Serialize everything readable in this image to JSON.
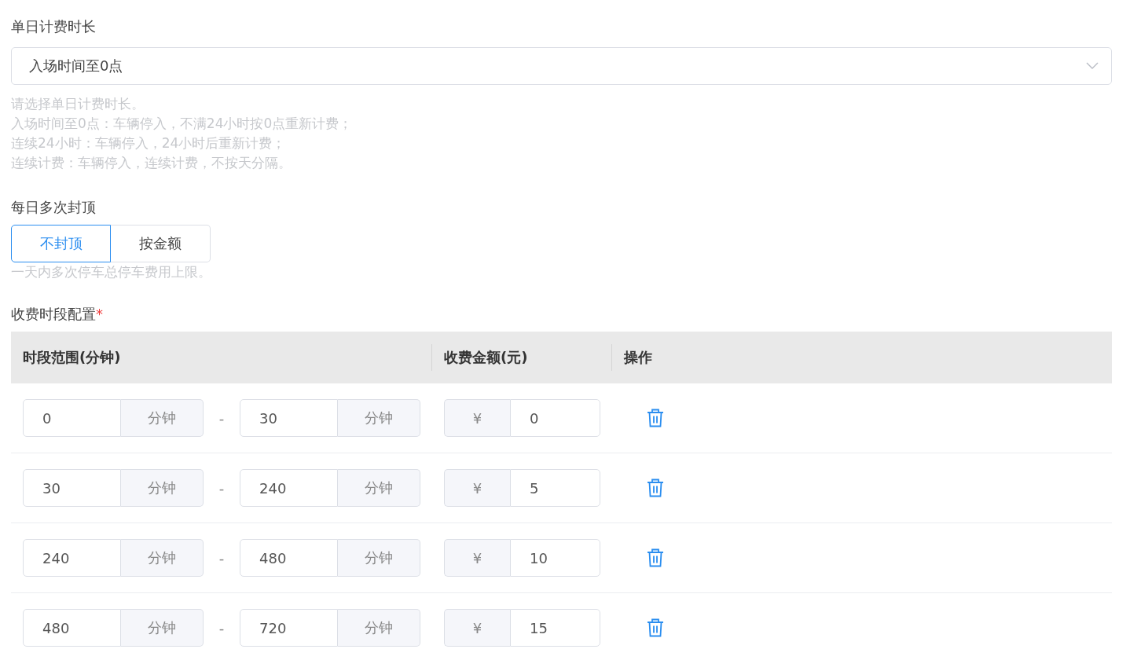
{
  "duration": {
    "label": "单日计费时长",
    "value": "入场时间至0点",
    "help": [
      "请选择单日计费时长。",
      "入场时间至0点：车辆停入，不满24小时按0点重新计费；",
      "连续24小时：车辆停入，24小时后重新计费；",
      "连续计费：车辆停入，连续计费，不按天分隔。"
    ]
  },
  "cap": {
    "label": "每日多次封顶",
    "options": [
      {
        "label": "不封顶",
        "selected": true
      },
      {
        "label": "按金额",
        "selected": false
      }
    ],
    "help": "一天内多次停车总停车费用上限。"
  },
  "periods": {
    "label": "收费时段配置",
    "required_mark": "*",
    "columns": [
      "时段范围(分钟)",
      "收费金额(元)",
      "操作"
    ],
    "rows": [
      {
        "from": "0",
        "from_unit": "分钟",
        "separator": "-",
        "to": "30",
        "to_unit": "分钟",
        "currency": "¥",
        "amount": "0"
      },
      {
        "from": "30",
        "from_unit": "分钟",
        "separator": "-",
        "to": "240",
        "to_unit": "分钟",
        "currency": "¥",
        "amount": "5"
      },
      {
        "from": "240",
        "from_unit": "分钟",
        "separator": "-",
        "to": "480",
        "to_unit": "分钟",
        "currency": "¥",
        "amount": "10"
      },
      {
        "from": "480",
        "from_unit": "分钟",
        "separator": "-",
        "to": "720",
        "to_unit": "分钟",
        "currency": "¥",
        "amount": "15"
      }
    ]
  }
}
